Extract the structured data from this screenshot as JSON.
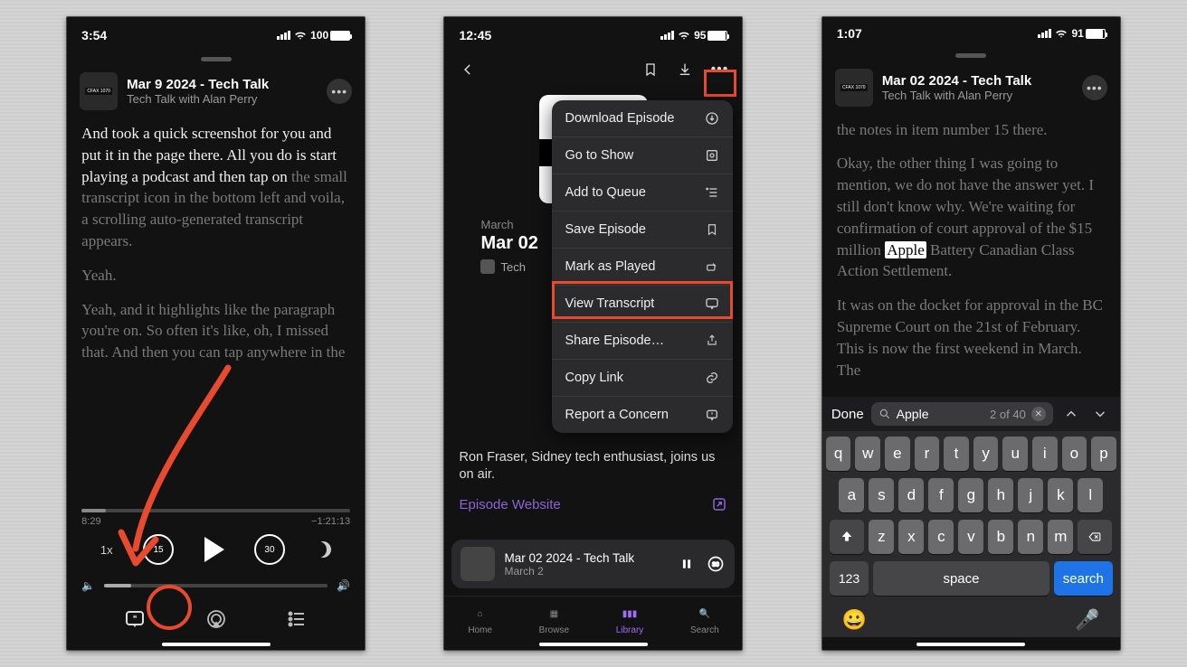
{
  "phone1": {
    "status": {
      "time": "3:54",
      "battery": "100"
    },
    "header": {
      "title": "Mar 9 2024 - Tech Talk",
      "subtitle": "Tech Talk with Alan Perry"
    },
    "transcript": {
      "p1_bright": "And took a quick screenshot for you and put it in the page there. All you do is start playing a podcast and then tap on ",
      "p1_dim": "the small transcript icon in the bottom left and voila, a scrolling auto-generated transcript appears.",
      "p2": "Yeah.",
      "p3": "Yeah, and it highlights like the paragraph you're on. So often it's like, oh, I missed that. And then you can tap anywhere in the"
    },
    "scrub": {
      "elapsed": "8:29",
      "remaining": "−1:21:13",
      "speed": "1x"
    }
  },
  "phone2": {
    "status": {
      "time": "12:45",
      "battery": "95"
    },
    "episode": {
      "date_label": "March",
      "title_partial": "Mar 02",
      "byline": "Tech"
    },
    "menu": {
      "download": "Download Episode",
      "goto": "Go to Show",
      "queue": "Add to Queue",
      "save": "Save Episode",
      "played": "Mark as Played",
      "transcript": "View Transcript",
      "share": "Share Episode…",
      "copy": "Copy Link",
      "report": "Report a Concern"
    },
    "description": "Ron Fraser, Sidney tech enthusiast, joins us on air.",
    "website_label": "Episode Website",
    "mini": {
      "title": "Mar 02 2024 - Tech Talk",
      "sub": "March 2"
    },
    "tabs": {
      "home": "Home",
      "browse": "Browse",
      "library": "Library",
      "search": "Search"
    }
  },
  "phone3": {
    "status": {
      "time": "1:07",
      "battery": "91"
    },
    "header": {
      "title": "Mar 02 2024 - Tech Talk",
      "subtitle": "Tech Talk with Alan Perry"
    },
    "transcript": {
      "p0": "the notes in item number 15 there.",
      "p1a": "Okay, the other thing I was going to mention, we do not have the answer yet. I still don't know why. We're waiting for confirmation of court approval of the $15 million ",
      "p1_hl": "Apple",
      "p1b": " Battery Canadian Class Action Settlement.",
      "p2": "It was on the docket for approval in the BC Supreme Court on the 21st of February. This is now the first weekend in March. The"
    },
    "search": {
      "done": "Done",
      "query": "Apple",
      "count": "2 of 40"
    },
    "keyboard": {
      "row1": [
        "q",
        "w",
        "e",
        "r",
        "t",
        "y",
        "u",
        "i",
        "o",
        "p"
      ],
      "row2": [
        "a",
        "s",
        "d",
        "f",
        "g",
        "h",
        "j",
        "k",
        "l"
      ],
      "row3": [
        "z",
        "x",
        "c",
        "v",
        "b",
        "n",
        "m"
      ],
      "num": "123",
      "space": "space",
      "search": "search"
    }
  }
}
